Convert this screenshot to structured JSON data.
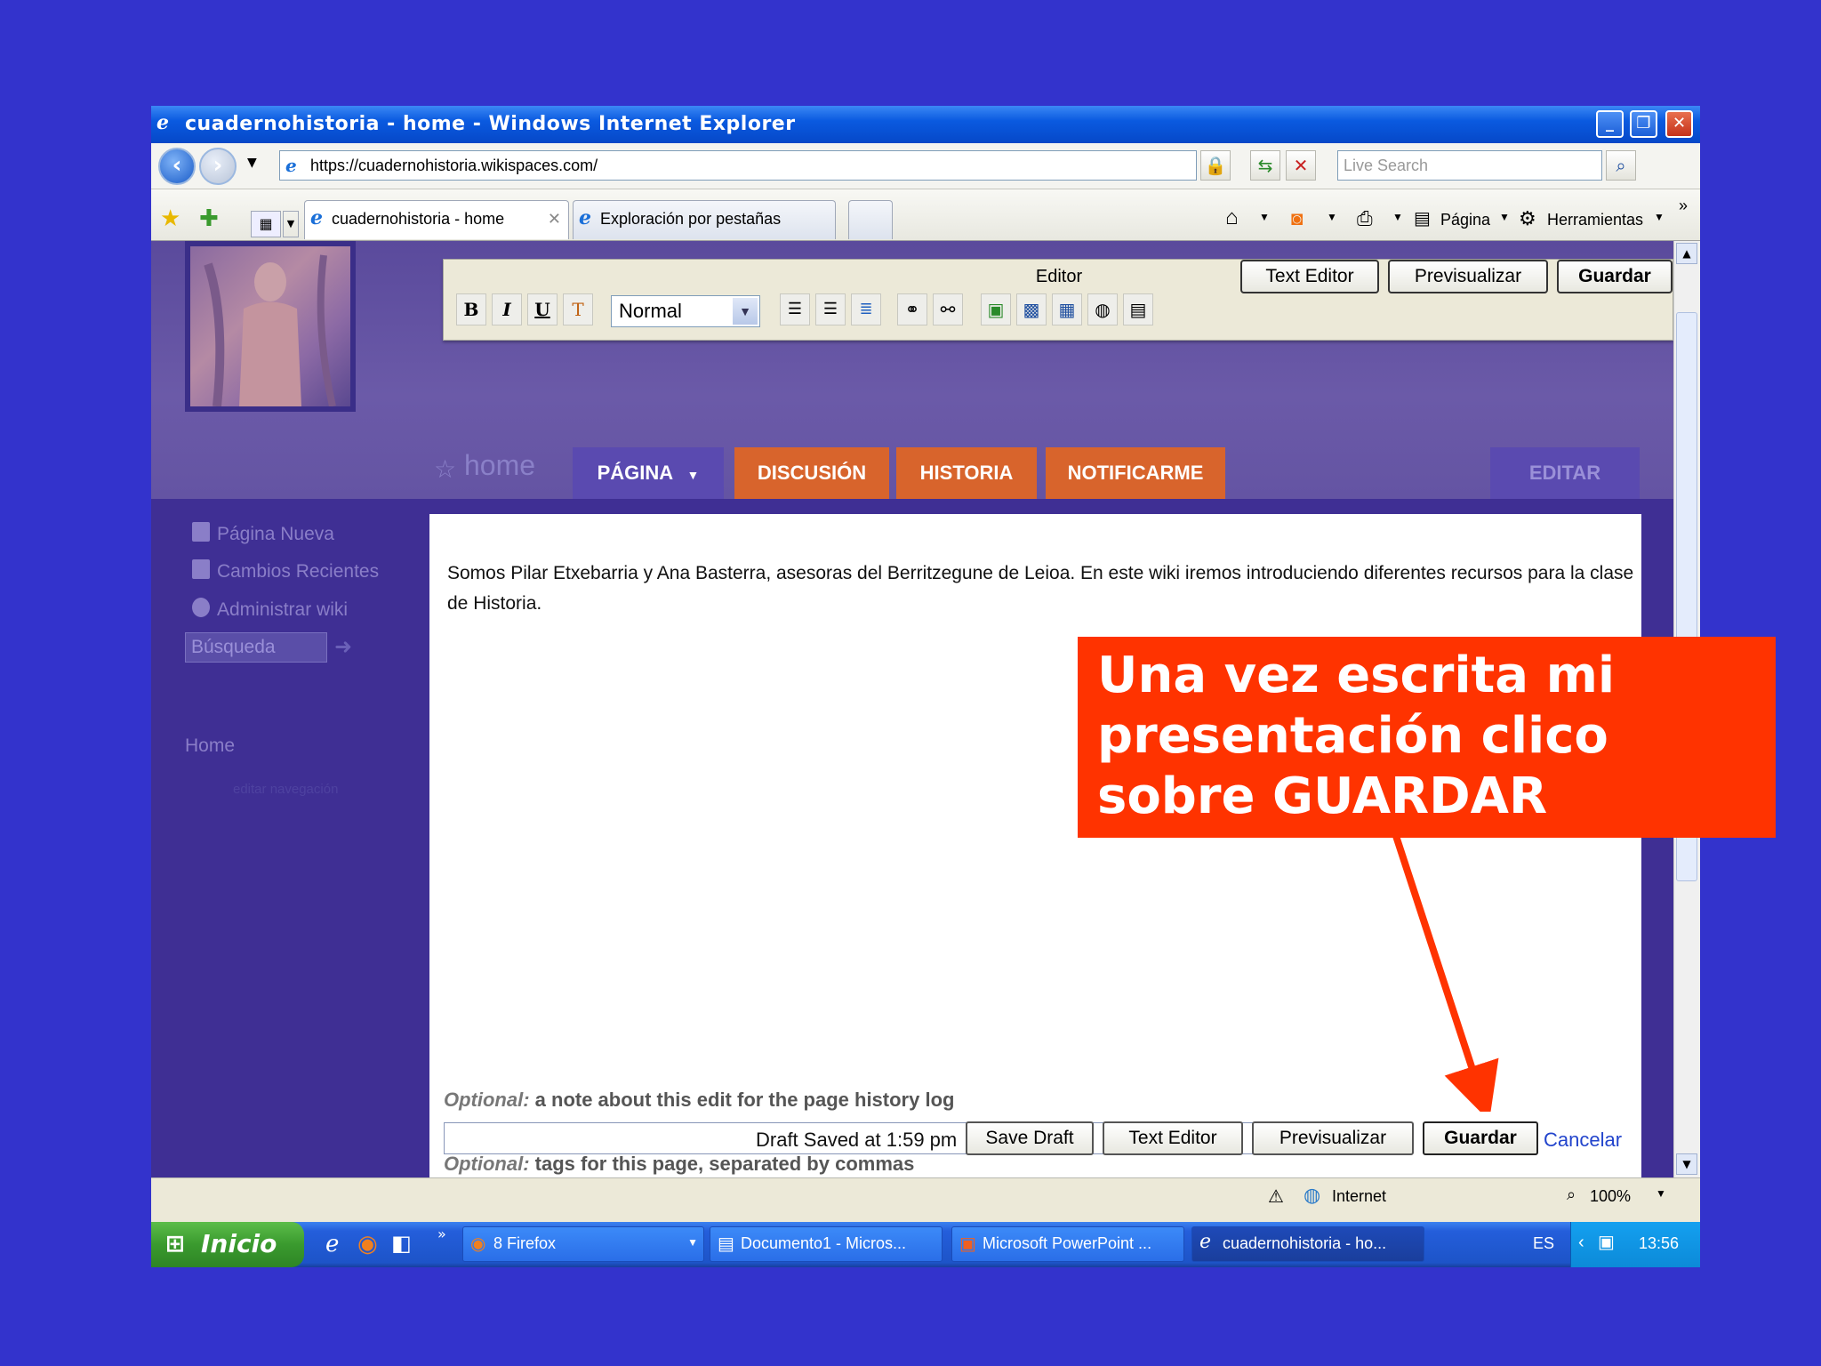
{
  "window": {
    "title": "cuadernohistoria - home - Windows Internet Explorer",
    "minimize": "_",
    "restore": "❐",
    "close": "✕"
  },
  "address": {
    "url": "https://cuadernohistoria.wikispaces.com/",
    "search_placeholder": "Live Search"
  },
  "tabs": [
    {
      "label": "cuadernohistoria - home"
    },
    {
      "label": "Exploración por pestañas"
    }
  ],
  "commandbar": {
    "pagina": "Página",
    "herramientas": "Herramientas"
  },
  "editor": {
    "title": "Editor",
    "format": "Normal",
    "bold": "B",
    "italic": "I",
    "underline": "U",
    "text_editor": "Text Editor",
    "preview": "Previsualizar",
    "save": "Guardar"
  },
  "wiki": {
    "page_name": "home",
    "nav": {
      "pagina": "PÁGINA",
      "discusion": "DISCUSIÓN",
      "historia": "HISTORIA",
      "notificarme": "NOTIFICARME",
      "editar": "EDITAR"
    },
    "sidebar": {
      "items": [
        "Página Nueva",
        "Cambios Recientes",
        "Administrar wiki"
      ],
      "search": "Búsqueda",
      "home": "Home",
      "edit_nav": "editar navegación"
    },
    "body": "Somos Pilar Etxebarria y Ana Basterra, asesoras del Berritzegune de Leioa. En este wiki iremos introduciendo diferentes recursos para la clase de Historia.",
    "note_label_prefix": "Optional:",
    "note_label": " a note about this edit for the page history log",
    "tags_label_prefix": "Optional:",
    "tags_label": " tags for this page, separated by commas",
    "draft_status": "Draft Saved at 1:59 pm",
    "save_draft": "Save Draft",
    "text_editor": "Text Editor",
    "preview": "Previsualizar",
    "save": "Guardar",
    "cancel": "Cancelar"
  },
  "statusbar": {
    "zone": "Internet",
    "zoom": "100%"
  },
  "taskbar": {
    "start": "Inicio",
    "items": [
      "8 Firefox",
      "Documento1 - Micros...",
      "Microsoft PowerPoint ...",
      "cuadernohistoria - ho..."
    ],
    "lang": "ES",
    "clock": "13:56"
  },
  "callout": {
    "text": "Una vez escrita mi presentación clico sobre GUARDAR"
  },
  "colors": {
    "slide_bg": "#3333cc",
    "callout": "#ff3300",
    "nav_orange": "#d8642c",
    "nav_purple": "#5a4ab0"
  }
}
